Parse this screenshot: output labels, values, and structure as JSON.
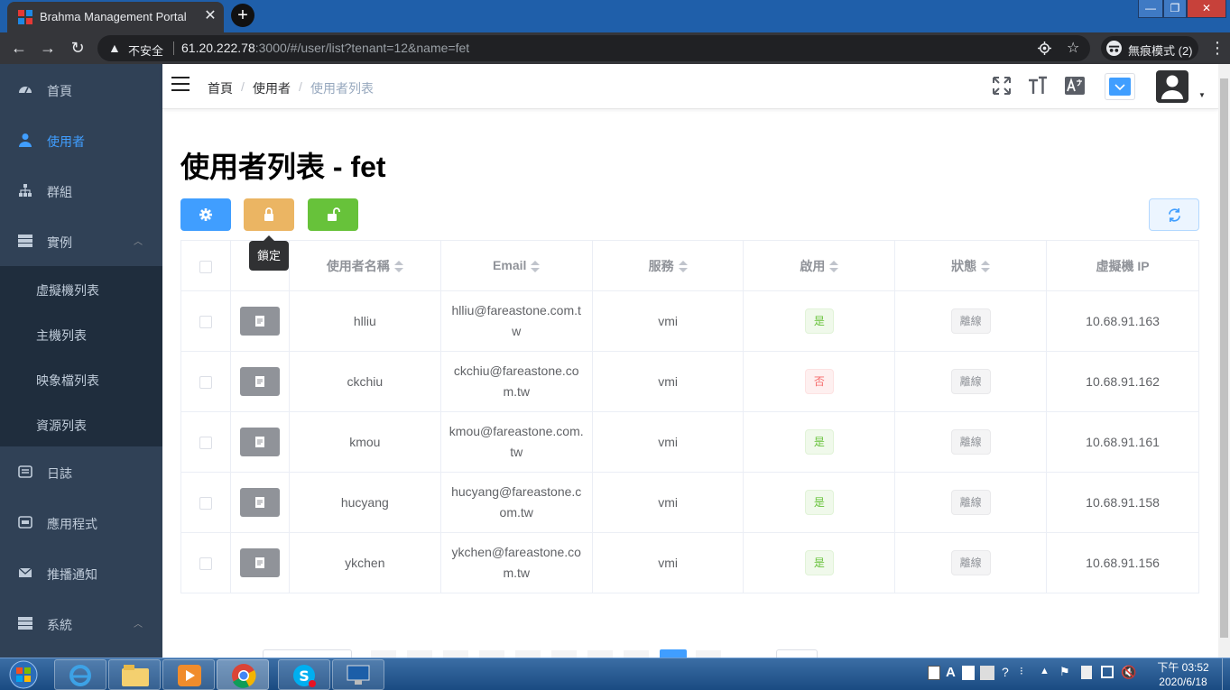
{
  "browser": {
    "tab_title": "Brahma Management Portal",
    "new_tab": "+",
    "close_tab": "✕",
    "security_label": "不安全",
    "url_host": "61.20.222.78",
    "url_path": ":3000/#/user/list?tenant=12&name=fet",
    "incognito_label": "無痕模式 (2)",
    "window_controls": [
      "—",
      "❐",
      "✕"
    ]
  },
  "sidebar": {
    "items": [
      {
        "label": "首頁",
        "icon": "dashboard-icon"
      },
      {
        "label": "使用者",
        "icon": "user-icon",
        "active": true
      },
      {
        "label": "群組",
        "icon": "tree-icon"
      },
      {
        "label": "實例",
        "icon": "server-icon",
        "expanded": true
      },
      {
        "label": "日誌",
        "icon": "log-icon"
      },
      {
        "label": "應用程式",
        "icon": "app-icon"
      },
      {
        "label": "推播通知",
        "icon": "mail-icon"
      },
      {
        "label": "系統",
        "icon": "server-icon",
        "expanded": true
      }
    ],
    "sub_items": [
      "虛擬機列表",
      "主機列表",
      "映象檔列表",
      "資源列表"
    ]
  },
  "navbar": {
    "breadcrumb": [
      "首頁",
      "使用者",
      "使用者列表"
    ],
    "breadcrumb_sep": "/"
  },
  "page": {
    "title": "使用者列表 - fet",
    "tooltip": "鎖定"
  },
  "table": {
    "headers": [
      "使用者名稱",
      "Email",
      "服務",
      "啟用",
      "狀態",
      "虛擬機 IP"
    ],
    "rows": [
      {
        "name": "hlliu",
        "email": "hlliu@fareastone.com.tw",
        "service": "vmi",
        "enabled": "是",
        "status": "離線",
        "ip": "10.68.91.163"
      },
      {
        "name": "ckchiu",
        "email": "ckchiu@fareastone.com.tw",
        "service": "vmi",
        "enabled": "否",
        "status": "離線",
        "ip": "10.68.91.162"
      },
      {
        "name": "kmou",
        "email": "kmou@fareastone.com.tw",
        "service": "vmi",
        "enabled": "是",
        "status": "離線",
        "ip": "10.68.91.161"
      },
      {
        "name": "hucyang",
        "email": "hucyang@fareastone.com.tw",
        "service": "vmi",
        "enabled": "是",
        "status": "離線",
        "ip": "10.68.91.158"
      },
      {
        "name": "ykchen",
        "email": "ykchen@fareastone.com.tw",
        "service": "vmi",
        "enabled": "是",
        "status": "離線",
        "ip": "10.68.91.156"
      }
    ]
  },
  "taskbar": {
    "time": "下午 03:52",
    "date": "2020/6/18"
  },
  "colors": {
    "sidebar_bg": "#304156",
    "sidebar_active": "#409eff",
    "primary": "#409eff",
    "warning": "#e6a23c",
    "success": "#67c23a",
    "info": "#909399"
  }
}
